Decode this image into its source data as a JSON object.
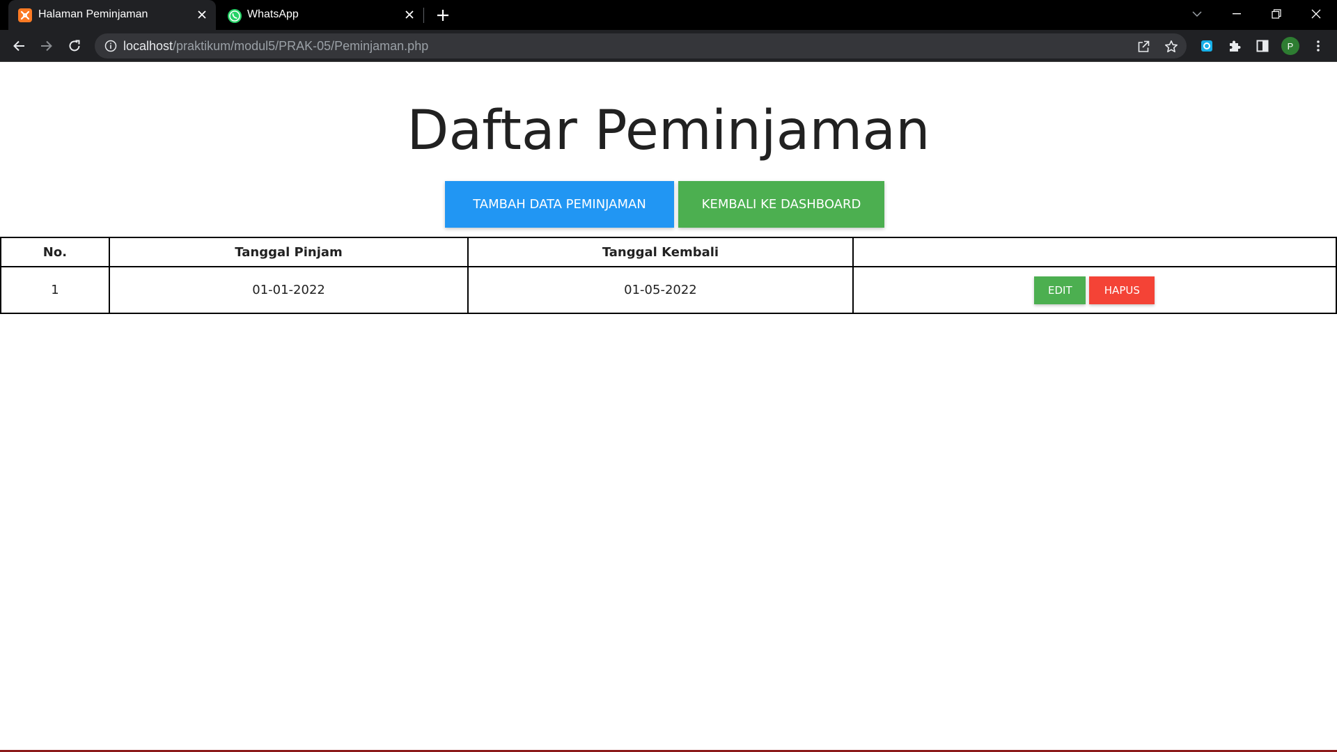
{
  "browser": {
    "tabs": [
      {
        "title": "Halaman Peminjaman",
        "icon": "xampp-icon",
        "active": true
      },
      {
        "title": "WhatsApp",
        "icon": "whatsapp-icon",
        "active": false
      }
    ],
    "url_host": "localhost",
    "url_path": "/praktikum/modul5/PRAK-05/Peminjaman.php",
    "profile_initial": "P"
  },
  "page": {
    "title": "Daftar Peminjaman",
    "buttons": {
      "add": "TAMBAH DATA PEMINJAMAN",
      "back": "KEMBALI KE DASHBOARD"
    },
    "table": {
      "headers": [
        "No.",
        "Tanggal Pinjam",
        "Tanggal Kembali",
        ""
      ],
      "rows": [
        {
          "no": "1",
          "tanggal_pinjam": "01-01-2022",
          "tanggal_kembali": "01-05-2022",
          "edit_label": "EDIT",
          "delete_label": "HAPUS"
        }
      ]
    }
  },
  "colors": {
    "blue_button": "#2196f3",
    "green_button": "#4caf50",
    "red_button": "#f44336"
  }
}
